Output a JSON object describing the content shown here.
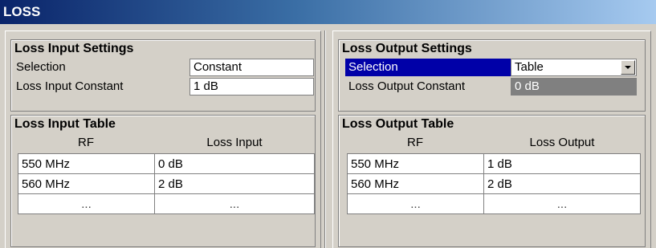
{
  "window": {
    "title": "LOSS"
  },
  "input": {
    "settings": {
      "title": "Loss Input Settings",
      "selection_label": "Selection",
      "selection_value": "Constant",
      "constant_label": "Loss Input Constant",
      "constant_value": "1 dB"
    },
    "table": {
      "title": "Loss Input Table",
      "headers": [
        "RF",
        "Loss Input"
      ],
      "rows": [
        [
          "550 MHz",
          "0 dB"
        ],
        [
          "560 MHz",
          "2 dB"
        ],
        [
          "...",
          "..."
        ]
      ]
    }
  },
  "output": {
    "settings": {
      "title": "Loss Output Settings",
      "selection_label": "Selection",
      "selection_value": "Table",
      "constant_label": "Loss Output Constant",
      "constant_value": "0 dB"
    },
    "table": {
      "title": "Loss Output Table",
      "headers": [
        "RF",
        "Loss Output"
      ],
      "rows": [
        [
          "550 MHz",
          "1 dB"
        ],
        [
          "560 MHz",
          "2 dB"
        ],
        [
          "...",
          "..."
        ]
      ]
    }
  },
  "colors": {
    "title_gradient_start": "#0a246a",
    "selection_highlight": "#0000a8",
    "disabled_field": "#808080",
    "background": "#d4d0c8"
  },
  "icons": {
    "dropdown": "chevron-down-icon"
  }
}
